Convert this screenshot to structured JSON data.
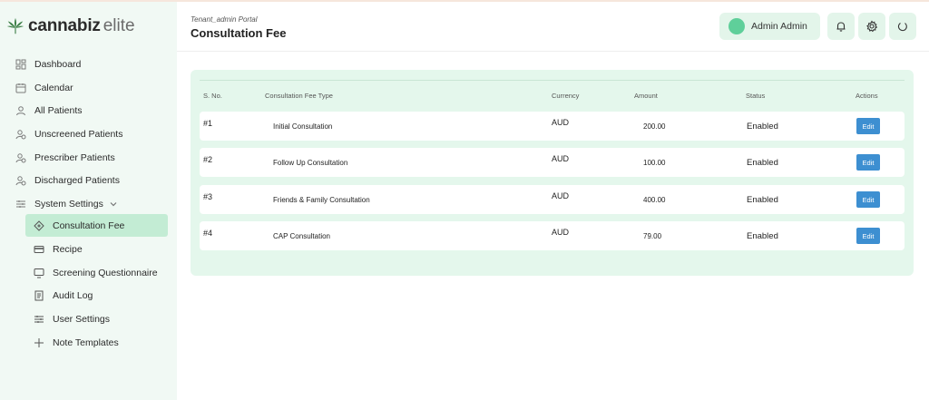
{
  "brand": {
    "bold": "cannabiz",
    "light": "elite"
  },
  "sidebar": {
    "items": [
      {
        "label": "Dashboard"
      },
      {
        "label": "Calendar"
      },
      {
        "label": "All Patients"
      },
      {
        "label": "Unscreened Patients"
      },
      {
        "label": "Prescriber Patients"
      },
      {
        "label": "Discharged Patients"
      },
      {
        "label": "System Settings"
      }
    ],
    "subitems": [
      {
        "label": "Consultation Fee",
        "active": true
      },
      {
        "label": "Recipe"
      },
      {
        "label": "Screening Questionnaire"
      },
      {
        "label": "Audit Log"
      },
      {
        "label": "User Settings"
      },
      {
        "label": "Note Templates"
      }
    ]
  },
  "header": {
    "portal": "Tenant_admin Portal",
    "title": "Consultation Fee",
    "user_name": "Admin Admin"
  },
  "table": {
    "headers": [
      "S. No.",
      "Consultation Fee Type",
      "Currency",
      "Amount",
      "Status",
      "Actions"
    ],
    "rows": [
      {
        "sno": "#1",
        "type": "Initial Consultation",
        "currency": "AUD",
        "amount": "200.00",
        "status": "Enabled",
        "action": "Edit"
      },
      {
        "sno": "#2",
        "type": "Follow Up Consultation",
        "currency": "AUD",
        "amount": "100.00",
        "status": "Enabled",
        "action": "Edit"
      },
      {
        "sno": "#3",
        "type": "Friends & Family Consultation",
        "currency": "AUD",
        "amount": "400.00",
        "status": "Enabled",
        "action": "Edit"
      },
      {
        "sno": "#4",
        "type": "CAP Consultation",
        "currency": "AUD",
        "amount": "79.00",
        "status": "Enabled",
        "action": "Edit"
      }
    ]
  },
  "colors": {
    "accent": "#3d8fd1",
    "sidebar_bg": "#f1f9f4",
    "active_bg": "#c3ecd4",
    "card_bg": "#e4f7ec",
    "avatar": "#5fcf9a"
  }
}
